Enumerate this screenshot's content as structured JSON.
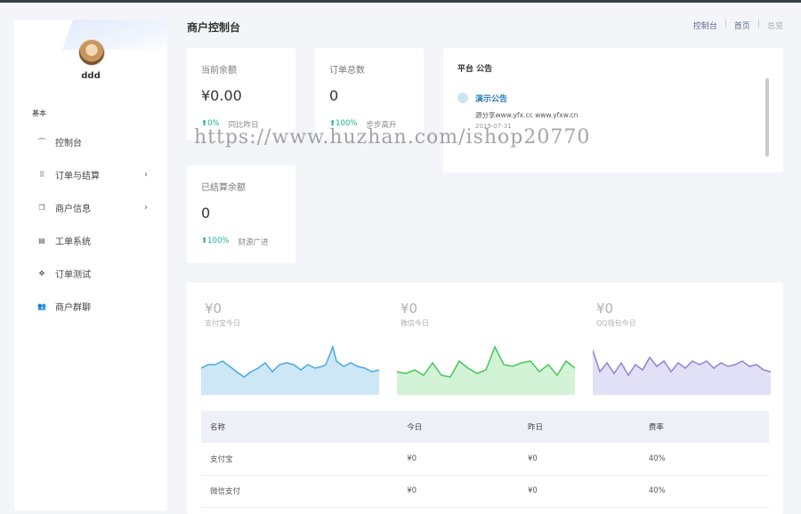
{
  "sidebar": {
    "username": "ddd",
    "section": "基本",
    "items": [
      {
        "label": "控制台",
        "icon": "gauge-icon",
        "glyph": "⌒",
        "chevron": false
      },
      {
        "label": "订单与结算",
        "icon": "grid-icon",
        "glyph": "⠿",
        "chevron": true
      },
      {
        "label": "商户信息",
        "icon": "copy-icon",
        "glyph": "❐",
        "chevron": true
      },
      {
        "label": "工单系统",
        "icon": "ticket-icon",
        "glyph": "▤",
        "chevron": false
      },
      {
        "label": "订单测试",
        "icon": "move-icon",
        "glyph": "✥",
        "chevron": false
      },
      {
        "label": "商户群聊",
        "icon": "users-icon",
        "glyph": "👥",
        "chevron": false
      }
    ],
    "chevron_glyph": "›"
  },
  "header": {
    "title": "商户控制台",
    "breadcrumb": [
      "控制台",
      "首页",
      "总览"
    ],
    "sep": "|"
  },
  "stats": [
    {
      "label": "当前余额",
      "value": "¥0.00",
      "change": "0%",
      "desc": "同比昨日"
    },
    {
      "label": "订单总数",
      "value": "0",
      "change": "100%",
      "desc": "步步高升"
    },
    {
      "label": "已结算余额",
      "value": "0",
      "change": "100%",
      "desc": "财源广进"
    }
  ],
  "arrow_up": "⬆",
  "notice": {
    "title": "平台 公告",
    "item_title": "演示公告",
    "body": "源分享www.yfx.cc www.yfxw.cn",
    "date": "2019-07-31"
  },
  "watermark": "https://www.huzhan.com/ishop20770",
  "payments": [
    {
      "value": "¥0",
      "label": "支付宝今日",
      "color": "#4aa8e0",
      "fill": "#cde7f7"
    },
    {
      "value": "¥0",
      "label": "微信今日",
      "color": "#46c75a",
      "fill": "#d3f3d6"
    },
    {
      "value": "¥0",
      "label": "QQ钱包今日",
      "color": "#8a84d6",
      "fill": "#e2e0f6"
    }
  ],
  "table": {
    "headers": [
      "名称",
      "今日",
      "昨日",
      "费率"
    ],
    "rows": [
      [
        "支付宝",
        "¥0",
        "¥0",
        "40%"
      ],
      [
        "微信支付",
        "¥0",
        "¥0",
        "40%"
      ]
    ]
  }
}
